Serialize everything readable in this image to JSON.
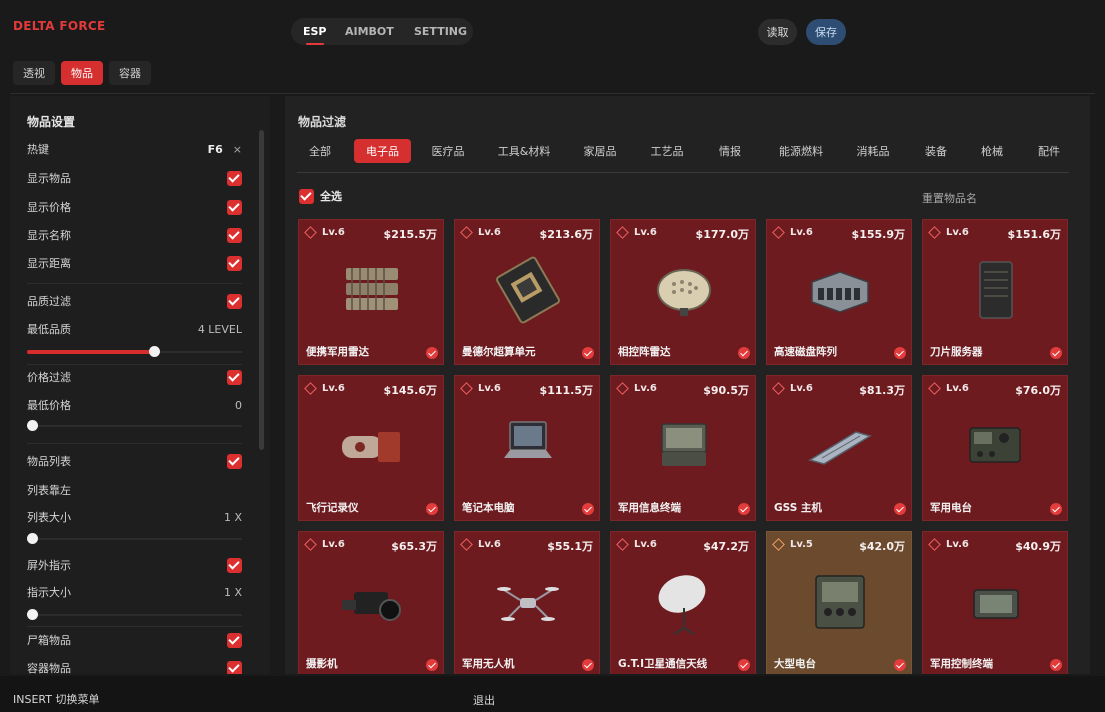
{
  "app": {
    "title": "DELTA FORCE"
  },
  "top_tabs": [
    "ESP",
    "AIMBOT",
    "SETTING"
  ],
  "buttons": {
    "load": "读取",
    "save": "保存"
  },
  "sub_tabs": [
    "透视",
    "物品",
    "容器"
  ],
  "left": {
    "title": "物品设置",
    "hotkey_label": "热键",
    "hotkey_value": "F6",
    "hotkey_clear": "×",
    "show_items": "显示物品",
    "show_price": "显示价格",
    "show_name": "显示名称",
    "show_distance": "显示距离",
    "quality_filter": "品质过滤",
    "min_quality": "最低品质",
    "min_quality_value": "4 LEVEL",
    "min_quality_level": 0.6,
    "price_filter": "价格过滤",
    "min_price": "最低价格",
    "min_price_value": "0",
    "min_price_level": 0,
    "item_list": "物品列表",
    "list_align": "列表靠左",
    "list_size": "列表大小",
    "list_size_value": "1 X",
    "list_size_level": 0,
    "offscreen": "屏外指示",
    "indicator_size": "指示大小",
    "indicator_size_value": "1 X",
    "indicator_size_level": 0,
    "corpse_items": "尸箱物品",
    "container_items": "容器物品"
  },
  "right": {
    "title": "物品过滤",
    "categories": [
      "全部",
      "电子品",
      "医疗品",
      "工具&材料",
      "家居品",
      "工艺品",
      "情报",
      "能源燃料",
      "消耗品",
      "装备",
      "枪械",
      "配件"
    ],
    "select_all": "全选",
    "reset_names": "重置物品名",
    "items": [
      {
        "level": "Lv.6",
        "price": "$215.5万",
        "name": "便携军用雷达",
        "icon": "radar-icon"
      },
      {
        "level": "Lv.6",
        "price": "$213.6万",
        "name": "曼德尔超算单元",
        "icon": "circuit-board-icon"
      },
      {
        "level": "Lv.6",
        "price": "$177.0万",
        "name": "相控阵雷达",
        "icon": "phased-array-icon"
      },
      {
        "level": "Lv.6",
        "price": "$155.9万",
        "name": "高速磁盘阵列",
        "icon": "disk-array-icon"
      },
      {
        "level": "Lv.6",
        "price": "$151.6万",
        "name": "刀片服务器",
        "icon": "server-icon"
      },
      {
        "level": "Lv.6",
        "price": "$145.6万",
        "name": "飞行记录仪",
        "icon": "flight-recorder-icon"
      },
      {
        "level": "Lv.6",
        "price": "$111.5万",
        "name": "笔记本电脑",
        "icon": "laptop-icon"
      },
      {
        "level": "Lv.6",
        "price": "$90.5万",
        "name": "军用信息终端",
        "icon": "terminal-icon"
      },
      {
        "level": "Lv.6",
        "price": "$81.3万",
        "name": "GSS 主机",
        "icon": "gss-host-icon"
      },
      {
        "level": "Lv.6",
        "price": "$76.0万",
        "name": "军用电台",
        "icon": "military-radio-icon"
      },
      {
        "level": "Lv.6",
        "price": "$65.3万",
        "name": "摄影机",
        "icon": "camera-icon"
      },
      {
        "level": "Lv.6",
        "price": "$55.1万",
        "name": "军用无人机",
        "icon": "drone-icon"
      },
      {
        "level": "Lv.6",
        "price": "$47.2万",
        "name": "G.T.I卫星通信天线",
        "icon": "satellite-dish-icon"
      },
      {
        "level": "Lv.5",
        "price": "$42.0万",
        "name": "大型电台",
        "icon": "large-radio-icon"
      },
      {
        "level": "Lv.6",
        "price": "$40.9万",
        "name": "军用控制终端",
        "icon": "control-terminal-icon"
      }
    ]
  },
  "footer": {
    "hint": "INSERT 切换菜单",
    "exit": "退出"
  },
  "colors": {
    "accent": "#d62f2f",
    "card_lv6": "#6e1b20",
    "card_lv5": "#6b4a2e",
    "save_button": "#2d4d72"
  }
}
